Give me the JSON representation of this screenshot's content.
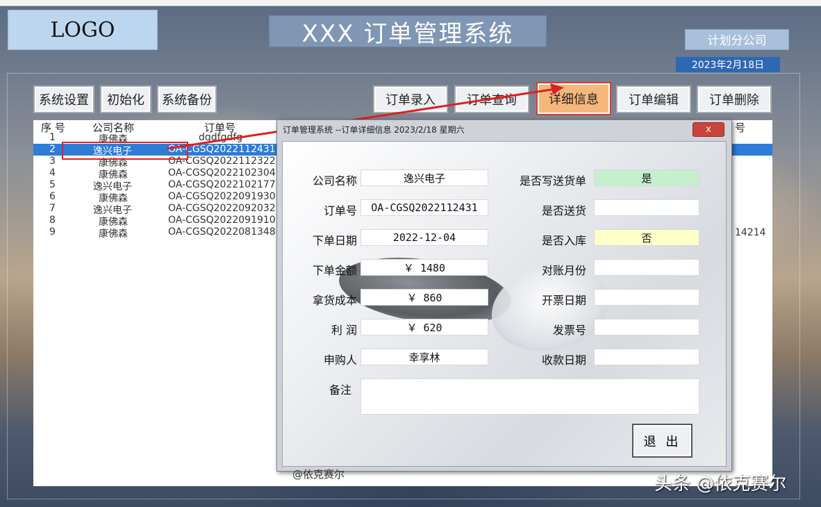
{
  "app": {
    "logo": "LOGO",
    "title": "XXX 订单管理系统",
    "branch": "计划分公司",
    "date": "2023年2月18日"
  },
  "toolbar_left": [
    "系统设置",
    "初始化",
    "系统备份"
  ],
  "toolbar_right": [
    "订单录入",
    "订单查询",
    "详细信息",
    "订单编辑",
    "订单删除"
  ],
  "list": {
    "headers": {
      "seq": "序 号",
      "company": "公司名称",
      "order_no": "订单号",
      "side": "号"
    },
    "rows": [
      {
        "seq": "1",
        "company": "康佛森",
        "order_no": "dgdfgdfg"
      },
      {
        "seq": "2",
        "company": "逸兴电子",
        "order_no": "OA-CGSQ2022112431"
      },
      {
        "seq": "3",
        "company": "康佛森",
        "order_no": "OA-CGSQ2022112322"
      },
      {
        "seq": "4",
        "company": "康佛森",
        "order_no": "OA-CGSQ2022102304"
      },
      {
        "seq": "5",
        "company": "逸兴电子",
        "order_no": "OA-CGSQ2022102177"
      },
      {
        "seq": "6",
        "company": "康佛森",
        "order_no": "OA-CGSQ2022091930"
      },
      {
        "seq": "7",
        "company": "逸兴电子",
        "order_no": "OA-CGSQ2022092032"
      },
      {
        "seq": "8",
        "company": "康佛森",
        "order_no": "OA-CGSQ2022091910"
      },
      {
        "seq": "9",
        "company": "康佛森",
        "order_no": "OA-CGSQ2022081348"
      }
    ],
    "side_value": "14214"
  },
  "dialog": {
    "title": "订单管理系统 --订单详细信息 2023/2/18 星期六",
    "close": "x",
    "left_fields": [
      {
        "label": "公司名称",
        "value": "逸兴电子"
      },
      {
        "label": "订单号",
        "value": "OA-CGSQ2022112431"
      },
      {
        "label": "下单日期",
        "value": "2022-12-04"
      },
      {
        "label": "下单金额",
        "value": "￥ 1480"
      },
      {
        "label": "拿货成本",
        "value": "￥ 860"
      },
      {
        "label": "利 润",
        "value": "￥ 620"
      },
      {
        "label": "申购人",
        "value": "幸享林"
      }
    ],
    "right_fields": [
      {
        "label": "是否写送货单",
        "value": "是"
      },
      {
        "label": "是否送货",
        "value": ""
      },
      {
        "label": "是否入库",
        "value": "否"
      },
      {
        "label": "对账月份",
        "value": ""
      },
      {
        "label": "开票日期",
        "value": ""
      },
      {
        "label": "发票号",
        "value": ""
      },
      {
        "label": "收款日期",
        "value": ""
      }
    ],
    "remark_label": "备注",
    "remark_value": "",
    "exit": "退 出",
    "credit": "@依克赛尔"
  },
  "watermark": "头条 @依克赛尔",
  "colors": {
    "accent": "#2e7bd8",
    "highlight": "#e02020",
    "active_button": "#f7b77a",
    "yes": "#c6efce",
    "no": "#ffffc8"
  }
}
